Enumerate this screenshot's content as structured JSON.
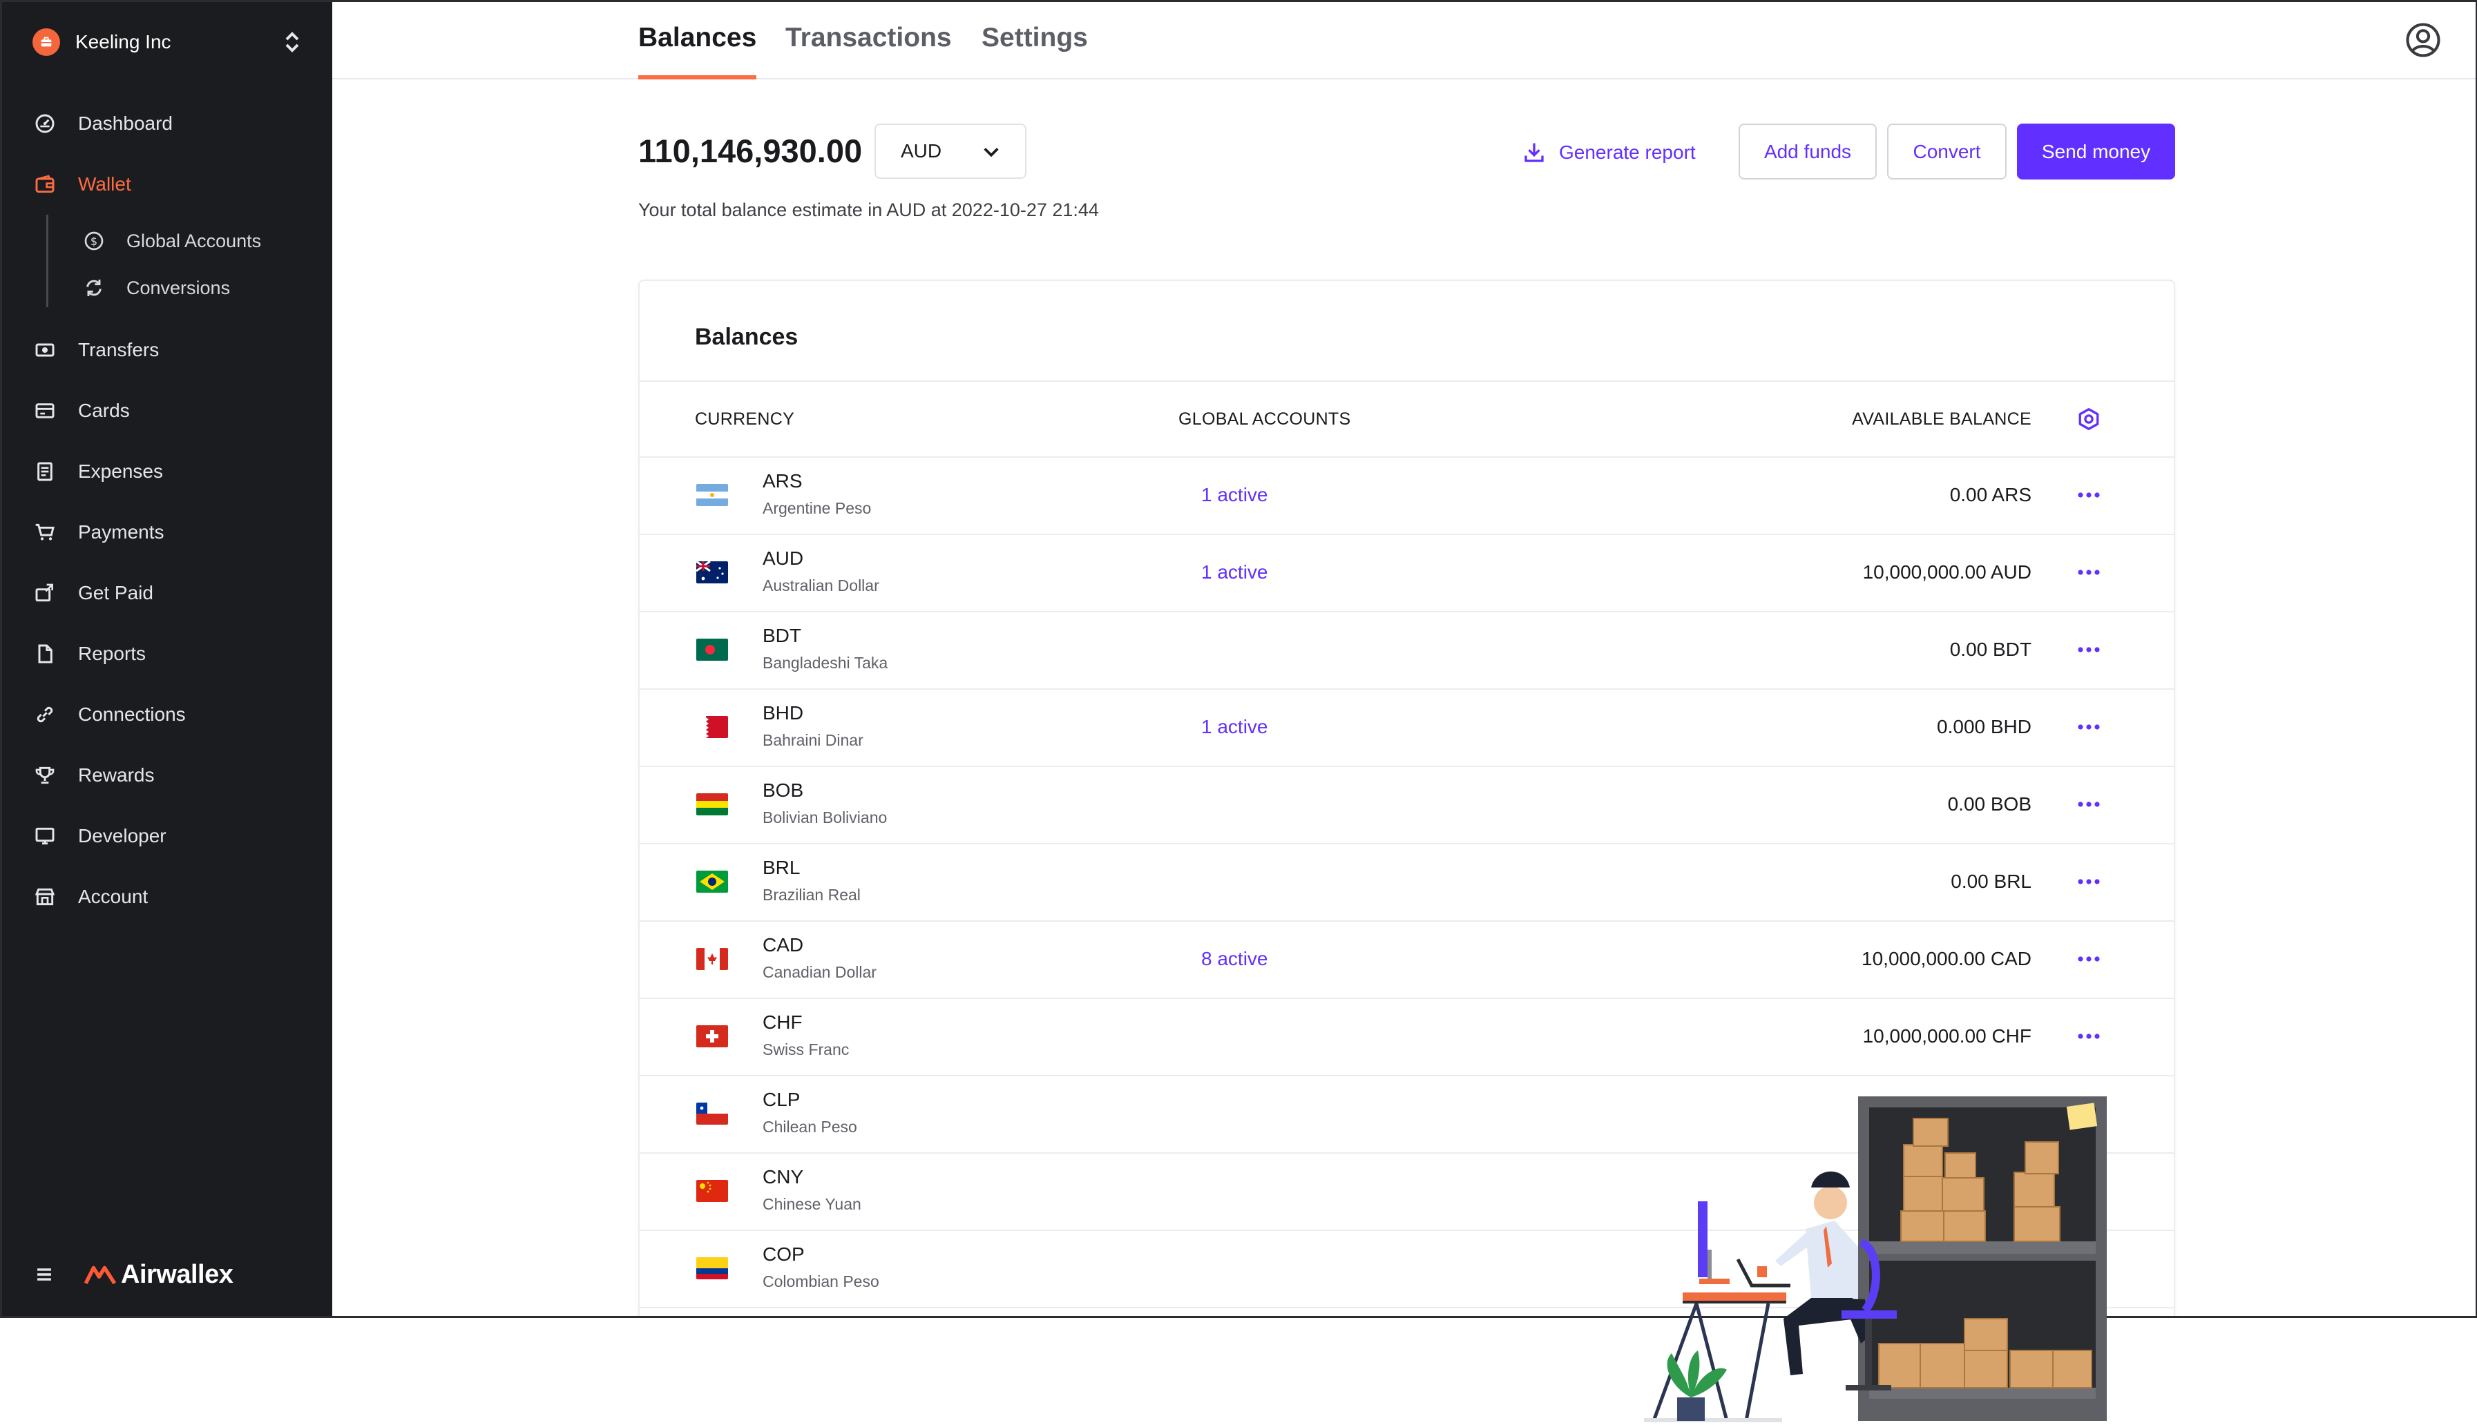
{
  "sidebar": {
    "org_name": "Keeling Inc",
    "nav": [
      {
        "label": "Dashboard",
        "icon": "dashboard-icon"
      },
      {
        "label": "Wallet",
        "icon": "wallet-icon",
        "active": true
      },
      {
        "label": "Transfers",
        "icon": "transfers-icon"
      },
      {
        "label": "Cards",
        "icon": "card-icon"
      },
      {
        "label": "Expenses",
        "icon": "receipt-icon"
      },
      {
        "label": "Payments",
        "icon": "cart-icon"
      },
      {
        "label": "Get Paid",
        "icon": "get-paid-icon"
      },
      {
        "label": "Reports",
        "icon": "document-icon"
      },
      {
        "label": "Connections",
        "icon": "link-icon"
      },
      {
        "label": "Rewards",
        "icon": "trophy-icon"
      },
      {
        "label": "Developer",
        "icon": "monitor-icon"
      },
      {
        "label": "Account",
        "icon": "store-icon"
      }
    ],
    "wallet_sub": [
      {
        "label": "Global Accounts",
        "icon": "dollar-circle-icon"
      },
      {
        "label": "Conversions",
        "icon": "refresh-icon"
      }
    ],
    "brand_name": "Airwallex"
  },
  "tabs": [
    {
      "label": "Balances",
      "active": true
    },
    {
      "label": "Transactions"
    },
    {
      "label": "Settings"
    }
  ],
  "summary": {
    "total": "110,146,930.00",
    "currency": "AUD",
    "estimate_text": "Your total balance estimate in AUD at 2022-10-27 21:44",
    "generate_report": "Generate report",
    "add_funds": "Add funds",
    "convert": "Convert",
    "send_money": "Send money"
  },
  "balances": {
    "title": "Balances",
    "headers": {
      "currency": "CURRENCY",
      "global_accounts": "GLOBAL ACCOUNTS",
      "available_balance": "AVAILABLE BALANCE"
    },
    "rows": [
      {
        "code": "ARS",
        "name": "Argentine Peso",
        "accounts": "1 active",
        "balance": "0.00 ARS"
      },
      {
        "code": "AUD",
        "name": "Australian Dollar",
        "accounts": "1 active",
        "balance": "10,000,000.00 AUD"
      },
      {
        "code": "BDT",
        "name": "Bangladeshi Taka",
        "accounts": "",
        "balance": "0.00 BDT"
      },
      {
        "code": "BHD",
        "name": "Bahraini Dinar",
        "accounts": "1 active",
        "balance": "0.000 BHD"
      },
      {
        "code": "BOB",
        "name": "Bolivian Boliviano",
        "accounts": "",
        "balance": "0.00 BOB"
      },
      {
        "code": "BRL",
        "name": "Brazilian Real",
        "accounts": "",
        "balance": "0.00 BRL"
      },
      {
        "code": "CAD",
        "name": "Canadian Dollar",
        "accounts": "8 active",
        "balance": "10,000,000.00 CAD"
      },
      {
        "code": "CHF",
        "name": "Swiss Franc",
        "accounts": "",
        "balance": "10,000,000.00 CHF"
      },
      {
        "code": "CLP",
        "name": "Chilean Peso",
        "accounts": "",
        "balance": ""
      },
      {
        "code": "CNY",
        "name": "Chinese Yuan",
        "accounts": "",
        "balance": ""
      },
      {
        "code": "COP",
        "name": "Colombian Peso",
        "accounts": "",
        "balance": ""
      }
    ]
  },
  "colors": {
    "accent": "#612fff",
    "brand_orange": "#ff6b42",
    "sidebar_bg": "#1b1c1f"
  }
}
